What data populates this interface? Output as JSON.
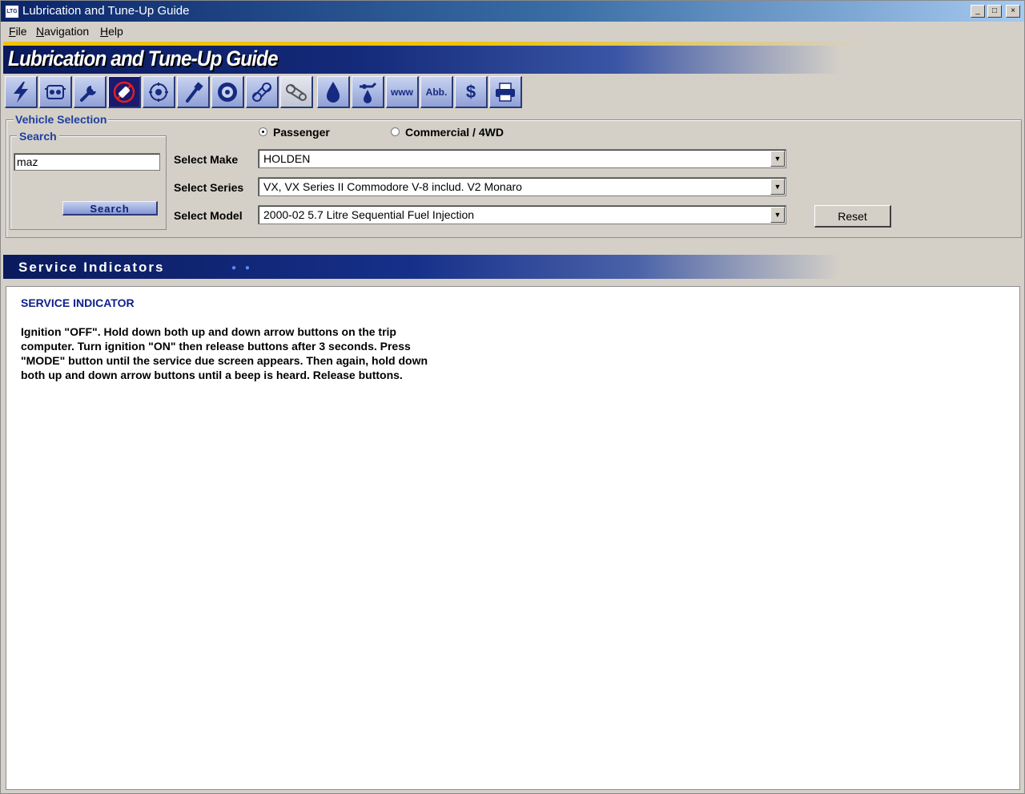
{
  "window": {
    "icon_text": "LTG",
    "title": "Lubrication and Tune-Up Guide",
    "controls": [
      "_",
      "□",
      "×"
    ]
  },
  "menu": [
    "File",
    "Navigation",
    "Help"
  ],
  "banner": {
    "title": "Lubrication and Tune-Up Guide"
  },
  "toolbar": {
    "icons": [
      "lightning-icon",
      "engine-icon",
      "wrench-icon",
      "spark-plug-icon",
      "distributor-icon",
      "bolt-icon",
      "wheel-icon",
      "timing-belt-icon",
      "belt-tensioner-icon",
      "oil-drop-icon",
      "oil-can-icon",
      "www-icon",
      "abbreviations-icon",
      "dollar-icon",
      "printer-icon"
    ],
    "www_label": "www",
    "abb_label": "Abb.",
    "dollar_label": "$"
  },
  "vehicle_selection": {
    "legend": "Vehicle Selection",
    "search": {
      "legend": "Search",
      "input_value": "maz",
      "button_label": "Search"
    },
    "type_options": [
      {
        "label": "Passenger",
        "checked": true
      },
      {
        "label": "Commercial / 4WD",
        "checked": false
      }
    ],
    "make": {
      "label": "Select Make",
      "value": "HOLDEN"
    },
    "series": {
      "label": "Select Series",
      "value": "VX, VX Series II Commodore V-8 includ. V2 Monaro"
    },
    "model": {
      "label": "Select Model",
      "value": "2000-02 5.7 Litre Sequential Fuel Injection"
    },
    "reset_label": "Reset"
  },
  "section": {
    "title": "Service Indicators"
  },
  "content": {
    "heading": "SERVICE INDICATOR",
    "body": "Ignition \"OFF\". Hold down both up and down arrow buttons on the trip computer. Turn ignition \"ON\" then release buttons after 3 seconds. Press \"MODE\" button until the service due screen appears. Then again, hold down both up and down arrow buttons until a beep is heard. Release buttons."
  }
}
